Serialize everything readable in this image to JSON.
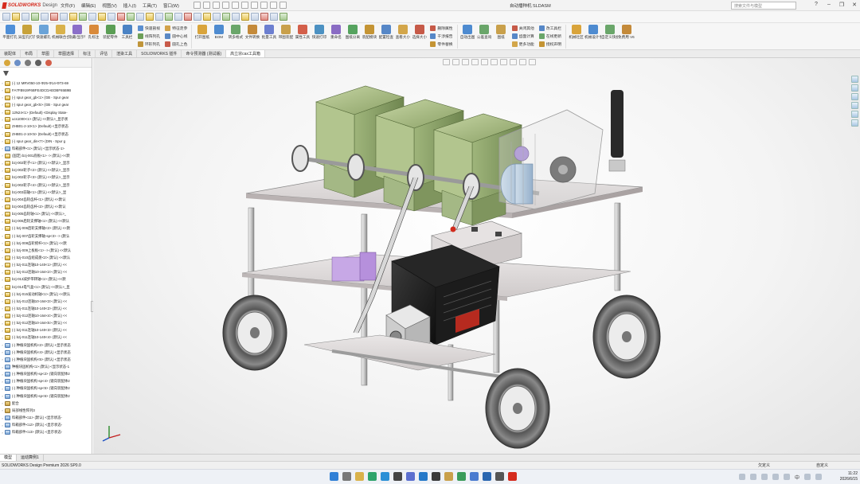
{
  "app": {
    "brand": "SOLIDWORKS",
    "brand_suffix": "Design",
    "menus": [
      "文件(F)",
      "编辑(E)",
      "视图(V)",
      "插入(I)",
      "工具(T)",
      "窗口(W)"
    ],
    "document_title": "自动播种机 SLDASM",
    "search_placeholder": "搜索文件与模型"
  },
  "window_controls": [
    "?",
    "–",
    "❐",
    "✕"
  ],
  "command_manager": {
    "big_tools": [
      {
        "label": "平面打孔",
        "color": "#4f8fd8"
      },
      {
        "label": "异型孔打孔",
        "color": "#c8a23a"
      },
      {
        "label": "快速螺孔",
        "color": "#6aa3d8"
      },
      {
        "label": "机械联合合",
        "color": "#d9b24b"
      },
      {
        "label": "隐藏/显示零件",
        "color": "#8b6fc9"
      },
      {
        "label": "孔标注",
        "color": "#d98a3a"
      },
      {
        "label": "装配零件",
        "color": "#5b9e55"
      },
      {
        "label": "工具栏",
        "color": "#4b83c4"
      }
    ],
    "small_col_1": [
      {
        "label": "快速剖视",
        "color": "#5b8fd0"
      },
      {
        "label": "线阵列孔",
        "color": "#6c9f58"
      },
      {
        "label": "环形列孔",
        "color": "#c0953a"
      }
    ],
    "small_col_2": [
      {
        "label": "特征走参",
        "color": "#d2a24a"
      },
      {
        "label": "圆中心线",
        "color": "#5a88c4"
      },
      {
        "label": "圆孔上色",
        "color": "#c85b4a"
      }
    ],
    "mid_tools": [
      {
        "label": "打开图纸",
        "color": "#d9a43b"
      },
      {
        "label": "BOM",
        "color": "#4e8bd0"
      },
      {
        "label": "转多格式",
        "color": "#6aa66a"
      },
      {
        "label": "文件转换",
        "color": "#c48a3a"
      },
      {
        "label": "批量工具",
        "color": "#6c7fd0"
      },
      {
        "label": "带图装配",
        "color": "#c9a04b"
      },
      {
        "label": "属性工具",
        "color": "#d35f4a"
      },
      {
        "label": "快速打印",
        "color": "#4c91c2"
      },
      {
        "label": "重命名",
        "color": "#8a6cc4"
      },
      {
        "label": "图纸分离",
        "color": "#56a35f"
      },
      {
        "label": "装配模块",
        "color": "#c49434"
      },
      {
        "label": "配置检查",
        "color": "#5687c7"
      },
      {
        "label": "查看大小",
        "color": "#d3a64a"
      },
      {
        "label": "选择大小",
        "color": "#c65a48"
      }
    ],
    "small_col_3": [
      {
        "label": "删除属性",
        "color": "#c65a48"
      },
      {
        "label": "干涉报告",
        "color": "#5687c7"
      },
      {
        "label": "零件替换",
        "color": "#c49434"
      }
    ],
    "right_tools": [
      {
        "label": "自动出图",
        "color": "#4e8bd0"
      },
      {
        "label": "公差查询",
        "color": "#6aa66a"
      },
      {
        "label": "图纸",
        "color": "#c9a04b"
      }
    ],
    "small_col_4": [
      {
        "label": "关闭其他",
        "color": "#c65a48"
      },
      {
        "label": "齿面计算",
        "color": "#5687c7"
      },
      {
        "label": "更多功能",
        "color": "#d3a64a"
      }
    ],
    "small_col_5": [
      {
        "label": "改工具栏",
        "color": "#5687c7"
      },
      {
        "label": "在线更新",
        "color": "#6aa66a"
      },
      {
        "label": "授权声明",
        "color": "#c49434"
      }
    ],
    "end_tools": [
      {
        "label": "机械社区",
        "color": "#d9a43b"
      },
      {
        "label": "机械设计手册",
        "color": "#4e8bd0"
      },
      {
        "label": "自定义快捷命令",
        "color": "#6aa66a"
      },
      {
        "label": "免费用 V6.6.3 正式版",
        "color": "#c48a3a"
      }
    ]
  },
  "tabs": [
    "装配体",
    "布局",
    "草图",
    "草图选择",
    "标注",
    "评估",
    "渲染工具",
    "SOLIDWORKS 插件",
    "命令预测器 (测试版)",
    "高立宗cax工具箱"
  ],
  "active_tab_index": 9,
  "tree_items": [
    {
      "label": "(-) 12 MRV050-10-Φ25-Φ14-Φ73-69",
      "type": "part"
    },
    {
      "label": "FA7FB919F6BFE4DCDAEDBF65B9B",
      "type": "part"
    },
    {
      "label": "(-) spur gear_gb<1> (GB - Spur gear",
      "type": "part"
    },
    {
      "label": "(-) spur gear_gb<5> (GB - Spur gear",
      "type": "part"
    },
    {
      "label": "12N24<1> (Default) <Display State-",
      "type": "part"
    },
    {
      "label": "ucs1000<1> (默认) <<默认>_显示状",
      "type": "part"
    },
    {
      "label": "ZHB01-2-10<1> (Default) <显示状态",
      "type": "part"
    },
    {
      "label": "ZHB01-2-10<5> (Default) <显示状态",
      "type": "part"
    },
    {
      "label": "(-) spur gear_din<7> (DIN - Spur g",
      "type": "part"
    },
    {
      "label": "料箱部件<1> (默认) <显示状态-1>",
      "type": "asm"
    },
    {
      "label": "(固定) bzj-001底板<1> -> (默认) <<默",
      "type": "part"
    },
    {
      "label": "bzj-002轮子<1> (默认) <<默认>_显示",
      "type": "part"
    },
    {
      "label": "bzj-002轮子<2> (默认) <<默认>_显示",
      "type": "part"
    },
    {
      "label": "bzj-002轮子<3> (默认) <<默认>_显示",
      "type": "part"
    },
    {
      "label": "bzj-002轮子<4> (默认) <<默认>_显示",
      "type": "part"
    },
    {
      "label": "bzj-003前轴<1> (默认) <<默认>_显",
      "type": "part"
    },
    {
      "label": "bzj-004齿轮齿杆<1> (默认) <<默认",
      "type": "part"
    },
    {
      "label": "bzj-004齿轮齿杆<2> (默认) <<默认",
      "type": "part"
    },
    {
      "label": "bzj-005齿轮轴<1> (默认) <<默认>_",
      "type": "part"
    },
    {
      "label": "bzj-006后轮支撑轴<1> (默认) <<默认",
      "type": "part"
    },
    {
      "label": "(-) bzj-006后轮支撑轴<2> (默认) <<默",
      "type": "part"
    },
    {
      "label": "(-) bzj-007齿轮支撑轴-sp<3> -> (默认",
      "type": "part"
    },
    {
      "label": "(-) bzj-008齿轮摇杆<1> (默认) <<默",
      "type": "part"
    },
    {
      "label": "(-) bzj-009上板板<1> -> (默认) <<默认",
      "type": "part"
    },
    {
      "label": "(-) bzj-010齿组成盘<2> (默认) <<默认",
      "type": "part"
    },
    {
      "label": "(-) bzj-011连轴10-140<1> (默认) <<",
      "type": "part"
    },
    {
      "label": "(-) bzj-012连轴10-164<2> (默认) <<",
      "type": "part"
    },
    {
      "label": "bzj-013减步带转轴<1> (默认) <<默",
      "type": "part"
    },
    {
      "label": "bzj-014电气盒<1> (默认) <<默认>_显",
      "type": "part"
    },
    {
      "label": "(-) bzj-015发动机轴<1> (默认) <<默认",
      "type": "part"
    },
    {
      "label": "(-) bzj-012连轴10-164<3> (默认) <<",
      "type": "part"
    },
    {
      "label": "(-) bzj-011连轴10-140<2> (默认) <<",
      "type": "part"
    },
    {
      "label": "(-) bzj-012连轴10-164<4> (默认) <<",
      "type": "part"
    },
    {
      "label": "(-) bzj-012连轴10-164<5> (默认) <<",
      "type": "part"
    },
    {
      "label": "(-) bzj-011连轴10-140<3> (默认) <<",
      "type": "part"
    },
    {
      "label": "(-) bzj-011连轴10-140<4> (默认) <<",
      "type": "part"
    },
    {
      "label": "(-) 种植块固机构<2> (默认) <显示状态",
      "type": "asm"
    },
    {
      "label": "(-) 种植块固机构<4> (默认) <显示状态",
      "type": "asm"
    },
    {
      "label": "(-) 种植块固机构<5> (默认) <显示状态",
      "type": "asm"
    },
    {
      "label": "种植块固机构<1> (默认) <显示状态-1",
      "type": "asm"
    },
    {
      "label": "(-) 种植块固机构-sp<2> (镜向装配体2",
      "type": "asm"
    },
    {
      "label": "(-) 种植块固机构-sp<4> (镜向装配体2",
      "type": "asm"
    },
    {
      "label": "(-) 种植块固机构-sp<5> (镜向装配体2",
      "type": "asm"
    },
    {
      "label": "(-) 种植块固机构-sp<6> (镜向装配体2",
      "type": "asm"
    },
    {
      "label": "配合",
      "type": "fold"
    },
    {
      "label": "局部线性阵列3",
      "type": "fold"
    },
    {
      "label": "料箱部件<11> (默认) <显示状态-",
      "type": "asm"
    },
    {
      "label": "料箱部件<12> (默认) <显示状态-",
      "type": "asm"
    },
    {
      "label": "料箱部件<13> (默认) <显示状态-",
      "type": "asm"
    }
  ],
  "bottom_tabs": [
    "模型",
    "运动算例1"
  ],
  "status": {
    "left": "SOLIDWORKS Design Premium 2026 SP0.0",
    "middle": "欠定义",
    "right": "自定义"
  },
  "taskbar": {
    "time": "11:22",
    "date": "2026/6/15",
    "ime": "中"
  }
}
